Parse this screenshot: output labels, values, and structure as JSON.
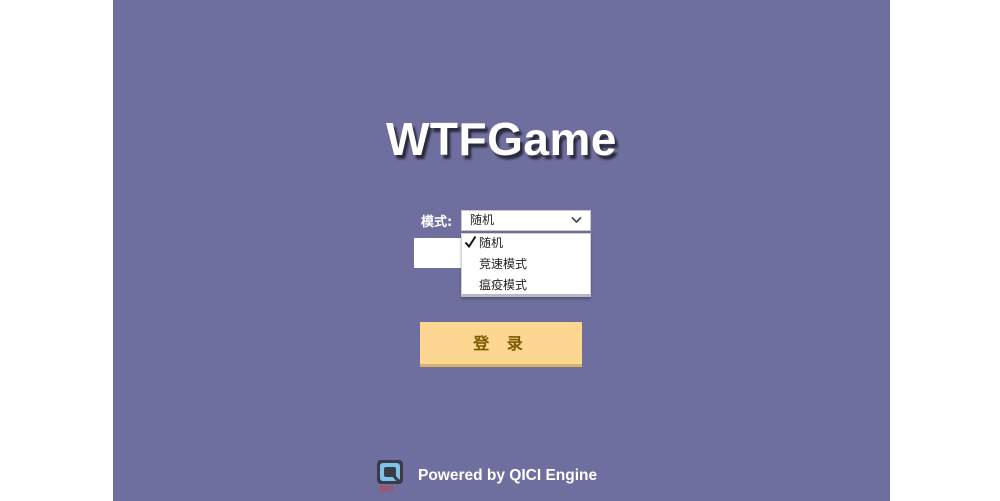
{
  "game": {
    "title": "WTFGame"
  },
  "mode": {
    "label": "模式:",
    "selected": "随机",
    "options": [
      "随机",
      "竞速模式",
      "瘟疫模式"
    ]
  },
  "login": {
    "label": "登 录"
  },
  "footer": {
    "powered_by": "Powered by QICI Engine"
  },
  "colors": {
    "background": "#6f6f9f",
    "button": "#fdd692",
    "button_text": "#7a5a00"
  },
  "icons": {
    "dropdown": "chevron-down-icon",
    "selected": "checkmark-icon",
    "logo": "qici-engine-logo"
  }
}
